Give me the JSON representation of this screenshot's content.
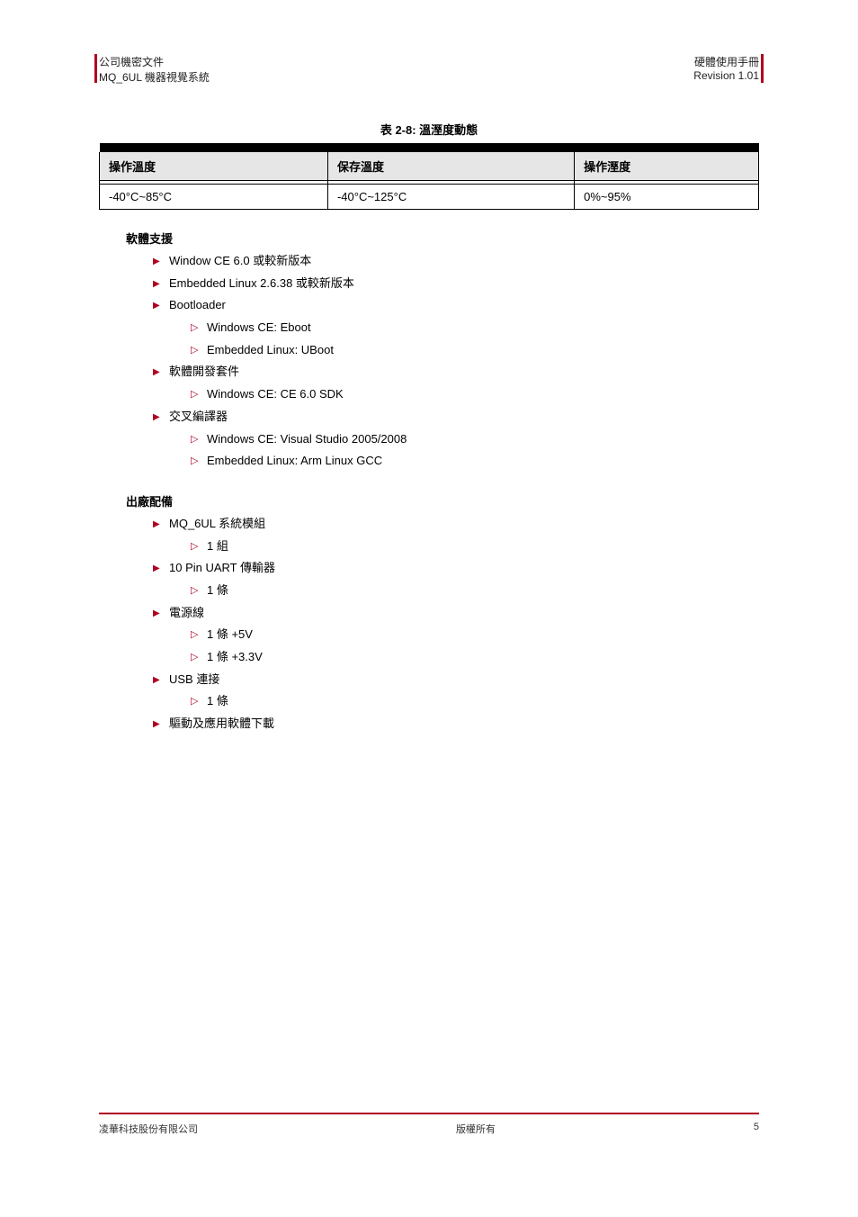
{
  "header": {
    "left_line1": "公司機密文件",
    "left_line2": "MQ_6UL 機器視覺系統",
    "right_line1": "硬體使用手冊",
    "right_line2": "Revision 1.01"
  },
  "table": {
    "caption": "表 2-8: 溫溼度動態",
    "headers": [
      "操作溫度",
      "保存溫度",
      "操作溼度"
    ],
    "row": [
      "-40°C~85°C",
      "-40°C~125°C",
      "0%~95%"
    ]
  },
  "groups": [
    {
      "title": "軟體支援",
      "items": [
        {
          "t": "Window CE 6.0 或較新版本"
        },
        {
          "t": "Embedded Linux 2.6.38 或較新版本"
        },
        {
          "t": "Bootloader",
          "children": [
            "Windows CE: Eboot",
            "Embedded Linux: UBoot"
          ]
        },
        {
          "t": "軟體開發套件",
          "children": [
            "Windows CE: CE 6.0 SDK"
          ]
        },
        {
          "t": "交叉編譯器",
          "children": [
            "Windows CE: Visual Studio 2005/2008",
            "Embedded Linux: Arm Linux GCC"
          ]
        }
      ]
    },
    {
      "title": "出廠配備",
      "items": [
        {
          "t": "MQ_6UL 系統模組",
          "children": [
            "1 組"
          ]
        },
        {
          "t": "10 Pin UART 傳輸器",
          "children": [
            "1 條"
          ]
        },
        {
          "t": "電源線",
          "children": [
            "1 條 +5V",
            "1 條 +3.3V"
          ]
        },
        {
          "t": "USB 連接",
          "children": [
            "1 條"
          ]
        },
        {
          "t": "驅動及應用軟體下載"
        }
      ]
    }
  ],
  "footer": {
    "left": "凌華科技股份有限公司",
    "center": "版權所有",
    "right": "5"
  }
}
